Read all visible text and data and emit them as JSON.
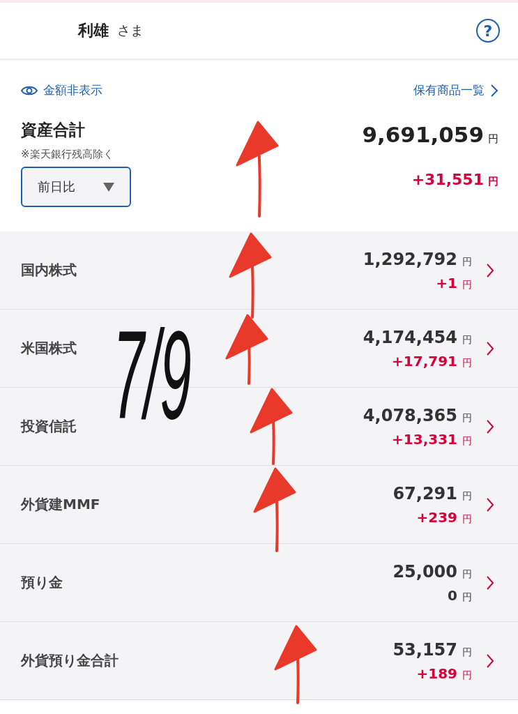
{
  "header": {
    "name": "利雄",
    "honorific": "さま",
    "help_icon": "?"
  },
  "summary": {
    "hide_toggle": "金額非表示",
    "holdings_link": "保有商品一覧",
    "title": "資産合計",
    "note": "※楽天銀行残高除く",
    "compare_select": "前日比",
    "total": "9,691,059",
    "total_unit": "円",
    "change": "+31,551",
    "change_unit": "円",
    "color": "#d7003a"
  },
  "rows": [
    {
      "label": "国内株式",
      "amount": "1,292,792",
      "amount_unit": "円",
      "change": "+1",
      "change_unit": "円",
      "color": "#d7003a"
    },
    {
      "label": "米国株式",
      "amount": "4,174,454",
      "amount_unit": "円",
      "change": "+17,791",
      "change_unit": "円",
      "color": "#d7003a"
    },
    {
      "label": "投資信託",
      "amount": "4,078,365",
      "amount_unit": "円",
      "change": "+13,331",
      "change_unit": "円",
      "color": "#d7003a"
    },
    {
      "label": "外貨建MMF",
      "amount": "67,291",
      "amount_unit": "円",
      "change": "+239",
      "change_unit": "円",
      "color": "#d7003a"
    },
    {
      "label": "預り金",
      "amount": "25,000",
      "amount_unit": "円",
      "change": "0",
      "change_unit": "円",
      "color": "#333333"
    },
    {
      "label": "外貨預り金合計",
      "amount": "53,157",
      "amount_unit": "円",
      "change": "+189",
      "change_unit": "円",
      "color": "#d7003a"
    }
  ],
  "annotation": {
    "handwritten_note": "7/9"
  }
}
